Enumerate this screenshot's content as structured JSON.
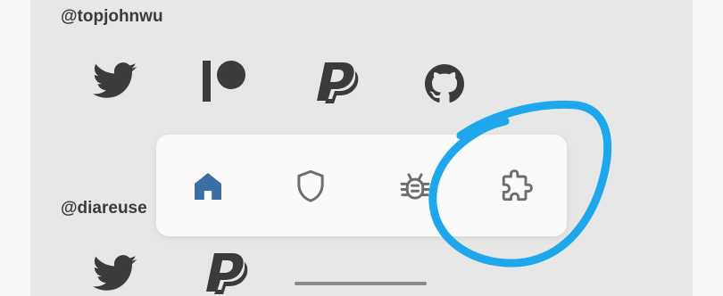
{
  "donate": {
    "sections": [
      {
        "handle": "@topjohnwu",
        "links": [
          "twitter-icon",
          "patreon-icon",
          "paypal-icon",
          "github-icon"
        ]
      },
      {
        "handle": "@diareuse",
        "links": [
          "twitter-icon",
          "paypal-icon"
        ]
      }
    ]
  },
  "bottom_nav": {
    "items": [
      {
        "icon": "home-icon",
        "selected": true
      },
      {
        "icon": "shield-icon",
        "selected": false
      },
      {
        "icon": "bug-icon",
        "selected": false
      },
      {
        "icon": "puzzle-icon",
        "selected": false
      }
    ]
  },
  "annotation": {
    "shape": "freehand-circle",
    "target": "puzzle-icon",
    "color": "#1ea7ec"
  },
  "colors": {
    "accent": "#3a6ea5",
    "icon": "#3b3b3b",
    "nav_icon": "#6e6e6e",
    "panel": "#e7e7e7",
    "navbar": "#fafafa"
  }
}
